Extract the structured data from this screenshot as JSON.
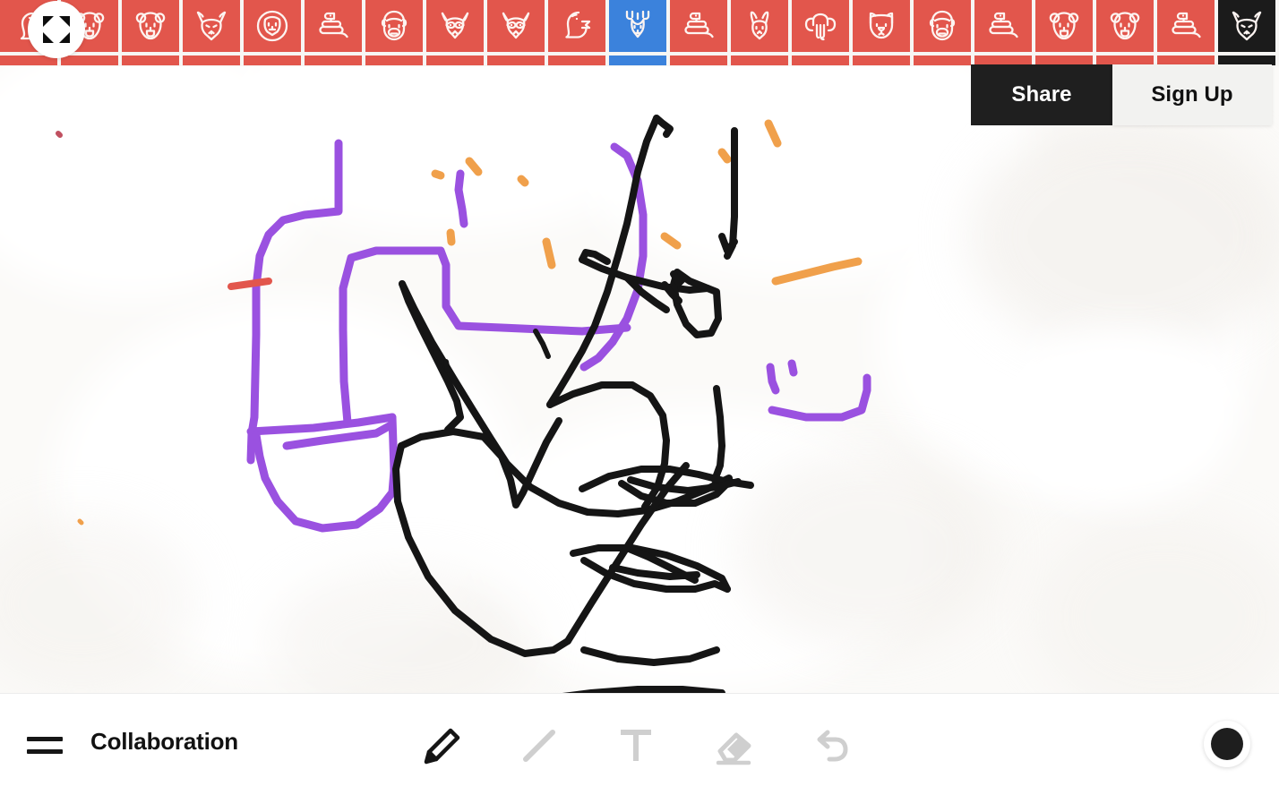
{
  "app": {
    "background_color": "#fbfaf8",
    "tile_red": "#e2564c",
    "tile_blue": "#3b82dc",
    "tile_dark": "#1b1b1b"
  },
  "top_strip": {
    "expand_button": {
      "icon": "expand-arrows-icon",
      "label": ""
    },
    "tiles": [
      {
        "icon": "animal-bird-icon",
        "state": "normal",
        "partial": true
      },
      {
        "icon": "animal-bear-icon",
        "state": "normal"
      },
      {
        "icon": "animal-bear-icon",
        "state": "normal"
      },
      {
        "icon": "animal-fox-icon",
        "state": "normal"
      },
      {
        "icon": "animal-lion-icon",
        "state": "normal"
      },
      {
        "icon": "animal-snake-icon",
        "state": "normal"
      },
      {
        "icon": "animal-gorilla-icon",
        "state": "normal"
      },
      {
        "icon": "animal-raccoon-icon",
        "state": "normal"
      },
      {
        "icon": "animal-raccoon-icon",
        "state": "normal"
      },
      {
        "icon": "animal-eagle-icon",
        "state": "normal"
      },
      {
        "icon": "animal-deer-icon",
        "state": "selected"
      },
      {
        "icon": "animal-snake-icon",
        "state": "normal"
      },
      {
        "icon": "animal-rabbit-icon",
        "state": "normal"
      },
      {
        "icon": "animal-elephant-icon",
        "state": "normal"
      },
      {
        "icon": "animal-dog-icon",
        "state": "normal"
      },
      {
        "icon": "animal-gorilla-icon",
        "state": "normal"
      },
      {
        "icon": "animal-snake-icon",
        "state": "normal"
      },
      {
        "icon": "animal-bear-icon",
        "state": "normal"
      },
      {
        "icon": "animal-bear-icon",
        "state": "normal"
      },
      {
        "icon": "animal-snake-icon",
        "state": "normal"
      },
      {
        "icon": "animal-fox-icon",
        "state": "dark"
      }
    ]
  },
  "account_bar": {
    "share_label": "Share",
    "signup_label": "Sign Up"
  },
  "drawing": {
    "title": "Collaboration",
    "stroke_colors": {
      "black": "#161616",
      "purple": "#9a51e0",
      "orange": "#f0a04b",
      "red": "#e2564c"
    }
  },
  "bottom_bar": {
    "menu_icon": "hamburger-menu-icon",
    "document_title": "Collaboration",
    "tools": [
      {
        "name": "pencil-tool",
        "icon": "pencil-icon",
        "state": "active"
      },
      {
        "name": "line-tool",
        "icon": "line-icon",
        "state": "inactive"
      },
      {
        "name": "text-tool",
        "icon": "text-t-icon",
        "state": "inactive"
      },
      {
        "name": "eraser-tool",
        "icon": "eraser-icon",
        "state": "inactive"
      },
      {
        "name": "undo-tool",
        "icon": "undo-arrow-icon",
        "state": "inactive"
      }
    ],
    "color_swatch": {
      "icon": "color-swatch-icon",
      "color": "#1e1e1e"
    }
  }
}
